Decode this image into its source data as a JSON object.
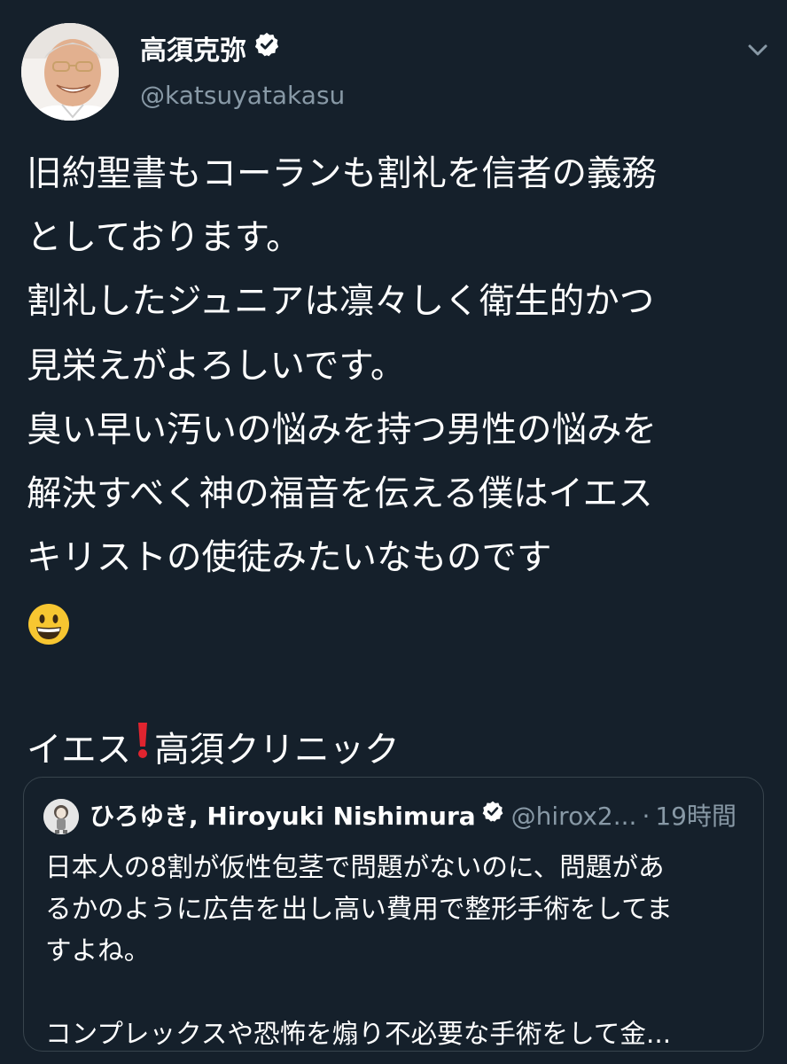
{
  "tweet": {
    "author": {
      "display_name": "高須克弥",
      "handle": "@katsuyatakasu",
      "verified": true,
      "avatar_icon": "avatar-photo"
    },
    "menu_icon": "chevron-down-icon",
    "text_lines": [
      "旧約聖書もコーランも割礼を信者の義務",
      "としております。",
      "割礼したジュニアは凛々しく衛生的かつ",
      "見栄えがよろしいです。",
      "臭い早い汚いの悩みを持つ男性の悩みを",
      "解決すべく神の福音を伝える僕はイエス",
      "キリストの使徒みたいなものです"
    ],
    "emoji": "grinning-face-emoji",
    "closing": {
      "before": "イエス",
      "emoji": "red-exclamation-emoji",
      "after": "高須クリニック"
    }
  },
  "quoted_tweet": {
    "display_name": "ひろゆき, Hiroyuki Nishimura",
    "verified": true,
    "handle": "@hirox2...",
    "separator": "·",
    "time": "19時間",
    "text_lines": [
      "日本人の8割が仮性包茎で問題がないのに、問題があ",
      "るかのように広告を出し高い費用で整形手術をしてま",
      "すよね。",
      "",
      "コンプレックスや恐怖を煽り不必要な手術をして金..."
    ]
  },
  "colors": {
    "background": "#15202b",
    "primary_text": "#ffffff",
    "secondary_text": "#8899a6",
    "border": "#38444d",
    "verified_badge": "#ffffff"
  }
}
